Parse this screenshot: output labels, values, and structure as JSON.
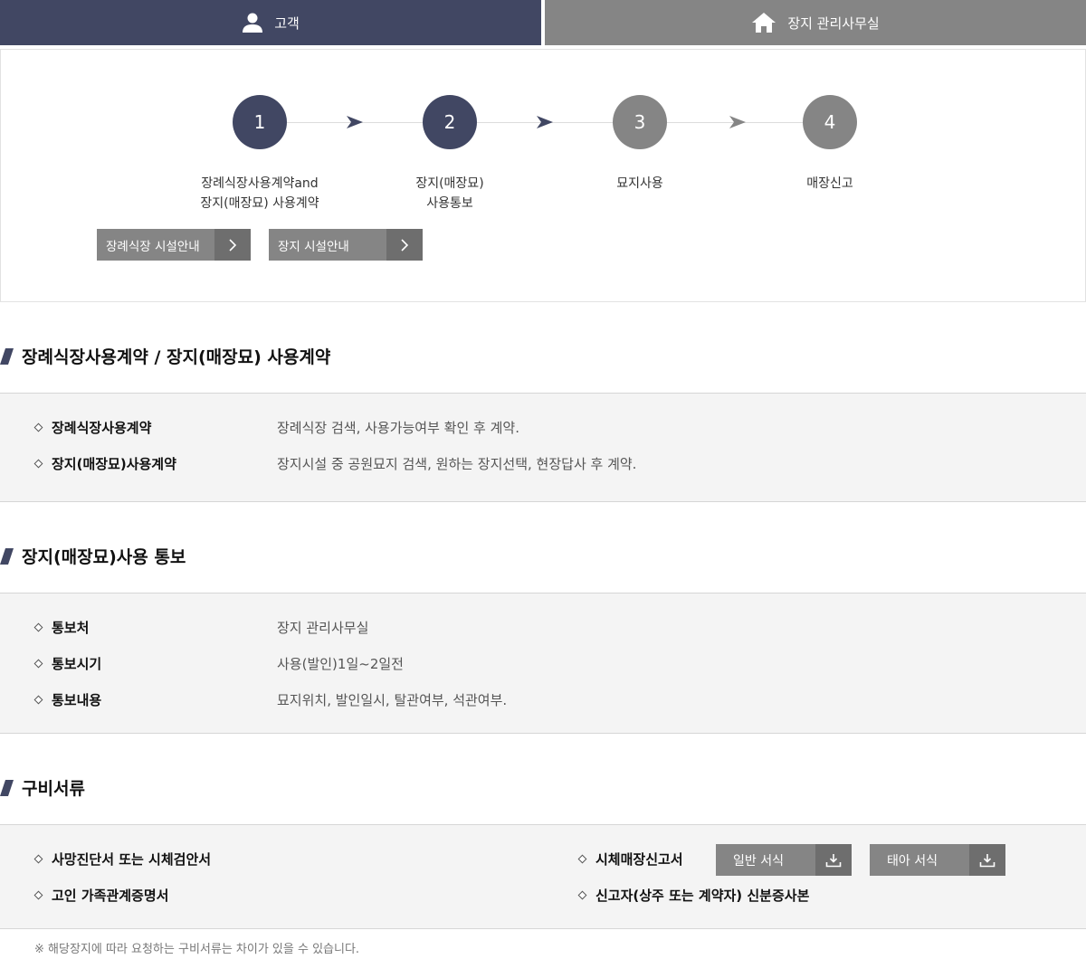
{
  "tabs": [
    {
      "label": "고객",
      "icon": "person-icon"
    },
    {
      "label": "장지 관리사무실",
      "icon": "home-icon"
    }
  ],
  "steps": [
    {
      "number": "1",
      "lines": [
        "장례식장사용계약and",
        "장지(매장묘) 사용계약"
      ]
    },
    {
      "number": "2",
      "lines": [
        "장지(매장묘)",
        "사용통보"
      ]
    },
    {
      "number": "3",
      "lines": [
        "묘지사용"
      ]
    },
    {
      "number": "4",
      "lines": [
        "매장신고"
      ]
    }
  ],
  "facility_buttons": [
    "장례식장 시설안내",
    "장지 시설안내"
  ],
  "sections": [
    {
      "title": "장례식장사용계약 / 장지(매장묘) 사용계약",
      "rows": [
        {
          "label": "장례식장사용계약",
          "value": "장례식장 검색, 사용가능여부 확인 후 계약."
        },
        {
          "label": "장지(매장묘)사용계약",
          "value": "장지시설 중 공원묘지 검색, 원하는 장지선택, 현장답사 후 계약."
        }
      ]
    },
    {
      "title": "장지(매장묘)사용 통보",
      "rows": [
        {
          "label": "통보처",
          "value": "장지 관리사무실"
        },
        {
          "label": "통보시기",
          "value": "사용(발인)1일~2일전"
        },
        {
          "label": "통보내용",
          "value": "묘지위치, 발인일시, 탈관여부, 석관여부."
        }
      ]
    },
    {
      "title": "구비서류",
      "left_items": [
        "사망진단서 또는 시체검안서",
        "고인 가족관계증명서"
      ],
      "right_items": [
        "시체매장신고서",
        "신고자(상주 또는 계약자) 신분증사본"
      ],
      "download_buttons": [
        "일반 서식",
        "태아 서식"
      ]
    }
  ],
  "footnote": "※ 해당장지에 따라 요청하는 구비서류는 차이가 있을 수 있습니다.",
  "colors": {
    "navy": "#414763",
    "gray": "#858585",
    "dark_gray": "#6e6e6e"
  }
}
